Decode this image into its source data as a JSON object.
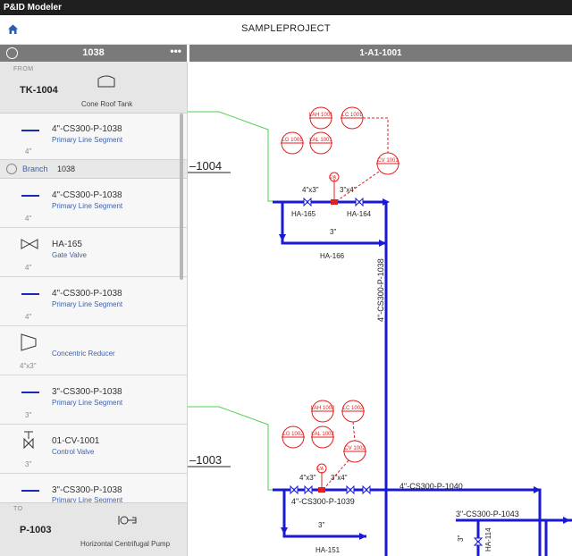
{
  "window": {
    "title": "P&ID Modeler"
  },
  "header": {
    "project": "SAMPLEPROJECT"
  },
  "panel": {
    "title": "1038",
    "from": {
      "label": "FROM",
      "tag": "TK-1004",
      "type": "Cone Roof Tank"
    },
    "branch": {
      "label": "Branch",
      "value": "1038"
    },
    "items": [
      {
        "name": "4\"-CS300-P-1038",
        "desc": "Primary Line Segment",
        "size": "4\""
      },
      {
        "name": "4\"-CS300-P-1038",
        "desc": "Primary Line Segment",
        "size": "4\""
      },
      {
        "name": "HA-165",
        "desc": "Gate Valve",
        "size": "4\""
      },
      {
        "name": "4\"-CS300-P-1038",
        "desc": "Primary Line Segment",
        "size": "4\""
      },
      {
        "name": "",
        "desc": "Concentric Reducer",
        "size": "4\"x3\""
      },
      {
        "name": "3\"-CS300-P-1038",
        "desc": "Primary Line Segment",
        "size": "3\""
      },
      {
        "name": "01-CV-1001",
        "desc": "Control Valve",
        "size": "3\""
      },
      {
        "name": "3\"-CS300-P-1038",
        "desc": "Primary Line Segment",
        "size": ""
      }
    ],
    "to": {
      "label": "TO",
      "tag": "P-1003",
      "type": "Horizontal Centrifugal Pump"
    }
  },
  "diagram": {
    "title": "1-A1-1001",
    "lines": {
      "l1004": "1004",
      "l1003": "1003",
      "v1038": "4\"-CS300-P-1038",
      "l1039": "4\"-CS300-P-1039",
      "l1040": "4\"-CS300-P-1040",
      "l1043": "3\"-CS300-P-1043"
    },
    "instruments_top": [
      "LAH 1001",
      "LC 1001",
      "LG 1001",
      "LAL 1001",
      "CV 1001"
    ],
    "instruments_bottom": [
      "LAH 1002",
      "LC 1002",
      "LG 1002",
      "LAL 1002",
      "CV 1002"
    ],
    "labels": {
      "r1a": "4\"x3\"",
      "r1b": "3\"x4\"",
      "ha165": "HA-165",
      "ha164": "HA-164",
      "byp1": "3\"",
      "ha166": "HA-166",
      "r2a": "4\"x3\"",
      "r2b": "3\"x4\"",
      "byp2": "3\"",
      "ha151": "HA-151",
      "ha114": "HA-114",
      "s3": "3\"",
      "ea": "E/A",
      "fourIn": "4\""
    }
  }
}
